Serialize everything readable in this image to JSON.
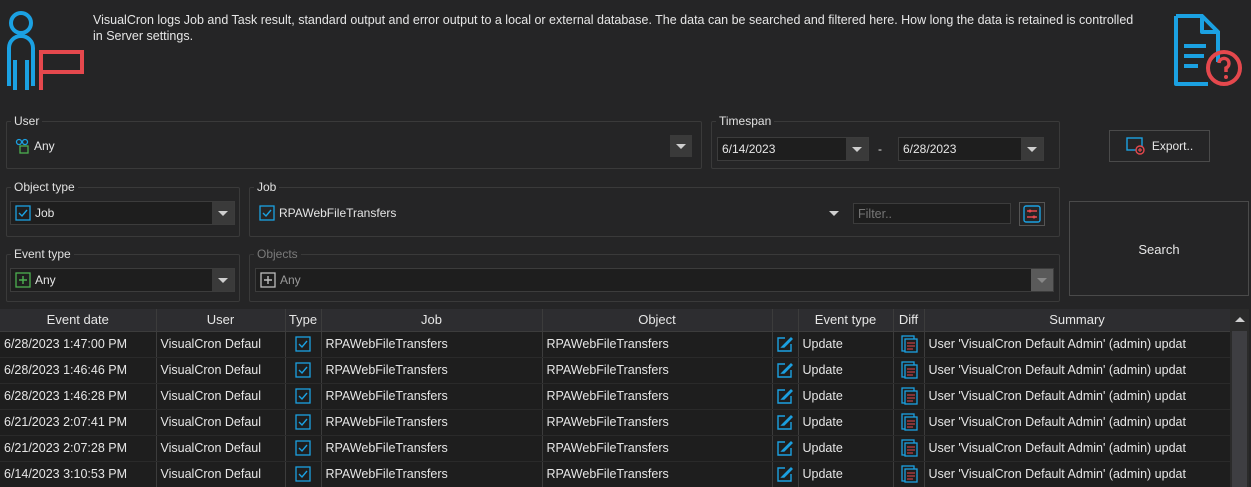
{
  "header": {
    "description": "VisualCron logs Job and Task result, standard output and error output to a local or external database. The data can be searched and filtered here. How long the data is retained is controlled in Server settings.",
    "person_icon": "person-flag-icon",
    "doc_icon": "document-question-icon"
  },
  "filters": {
    "user": {
      "label": "User",
      "value": "Any",
      "icon": "users-icon"
    },
    "timespan": {
      "label": "Timespan",
      "from": "6/14/2023",
      "separator": "-",
      "to": "6/28/2023"
    },
    "export_label": "Export..",
    "object_type": {
      "label": "Object type",
      "value": "Job",
      "icon": "checkbox-icon"
    },
    "job": {
      "label": "Job",
      "value": "RPAWebFileTransfers",
      "filter_placeholder": "Filter..",
      "icon": "checkbox-icon"
    },
    "event_type": {
      "label": "Event type",
      "value": "Any",
      "icon": "plus-box-icon"
    },
    "objects": {
      "label": "Objects",
      "value": "Any",
      "icon": "plus-box-icon"
    },
    "search_label": "Search"
  },
  "colors": {
    "accent_cyan": "#1ba1e2",
    "accent_red": "#e5484d"
  },
  "table": {
    "columns": [
      "Event date",
      "User",
      "Type",
      "Job",
      "Object",
      "",
      "Event type",
      "Diff",
      "Summary"
    ],
    "rows": [
      {
        "date": "6/28/2023 1:47:00 PM",
        "user": "VisualCron Defaul",
        "job": "RPAWebFileTransfers",
        "object": "RPAWebFileTransfers",
        "event": "Update",
        "summary": "User 'VisualCron Default Admin' (admin) updat"
      },
      {
        "date": "6/28/2023 1:46:46 PM",
        "user": "VisualCron Defaul",
        "job": "RPAWebFileTransfers",
        "object": "RPAWebFileTransfers",
        "event": "Update",
        "summary": "User 'VisualCron Default Admin' (admin) updat"
      },
      {
        "date": "6/28/2023 1:46:28 PM",
        "user": "VisualCron Defaul",
        "job": "RPAWebFileTransfers",
        "object": "RPAWebFileTransfers",
        "event": "Update",
        "summary": "User 'VisualCron Default Admin' (admin) updat"
      },
      {
        "date": "6/21/2023 2:07:41 PM",
        "user": "VisualCron Defaul",
        "job": "RPAWebFileTransfers",
        "object": "RPAWebFileTransfers",
        "event": "Update",
        "summary": "User 'VisualCron Default Admin' (admin) updat"
      },
      {
        "date": "6/21/2023 2:07:28 PM",
        "user": "VisualCron Defaul",
        "job": "RPAWebFileTransfers",
        "object": "RPAWebFileTransfers",
        "event": "Update",
        "summary": "User 'VisualCron Default Admin' (admin) updat"
      },
      {
        "date": "6/14/2023 3:10:53 PM",
        "user": "VisualCron Defaul",
        "job": "RPAWebFileTransfers",
        "object": "RPAWebFileTransfers",
        "event": "Update",
        "summary": "User 'VisualCron Default Admin' (admin) updat"
      }
    ]
  }
}
